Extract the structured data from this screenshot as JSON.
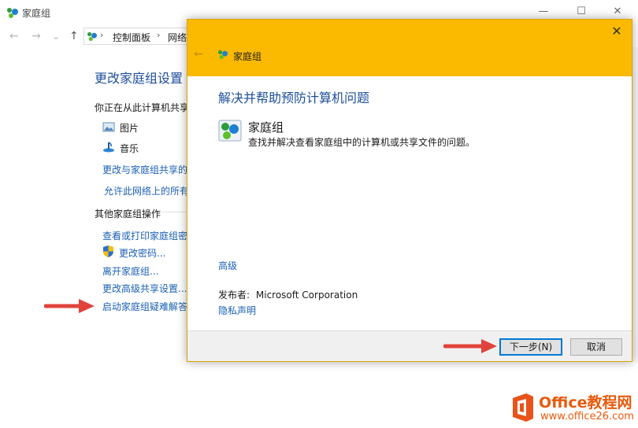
{
  "background_window": {
    "title": "家庭组",
    "controls": {
      "minimize": "—",
      "maximize": "☐",
      "close": "✕"
    },
    "nav": {
      "back": "←",
      "forward": "→",
      "dropdown": "⌄",
      "up": "↑"
    },
    "breadcrumb": [
      "控制面板",
      "网络"
    ],
    "heading": "更改家庭组设置",
    "sharing_label": "你正在从此计算机共享",
    "shared_items": [
      "图片",
      "音乐"
    ],
    "links_top": [
      "更改与家庭组共享的",
      "允许此网络上的所有"
    ],
    "other_actions_label": "其他家庭组操作",
    "actions": [
      "查看或打印家庭组密",
      "更改密码...",
      "离开家庭组...",
      "更改高级共享设置...",
      "启动家庭组疑难解答"
    ]
  },
  "dialog": {
    "title": "家庭组",
    "heading": "解决并帮助预防计算机问题",
    "item_name": "家庭组",
    "item_description": "查找并解决查看家庭组中的计算机或共享文件的问题。",
    "advanced_link": "高级",
    "publisher_label": "发布者:",
    "publisher_value": "Microsoft Corporation",
    "privacy_link": "隐私声明",
    "next_button": "下一步(N)",
    "cancel_button": "取消",
    "close_glyph": "✕",
    "back_glyph": "←"
  },
  "watermark": {
    "brand": "Office教程网",
    "url": "www.office26.com"
  },
  "colors": {
    "dialog_header": "#fbb900",
    "heading_blue": "#1e4e9a",
    "link_blue": "#1a5fb4",
    "annotation_arrow": "#e0433b",
    "watermark_orange": "#e85a0c"
  }
}
